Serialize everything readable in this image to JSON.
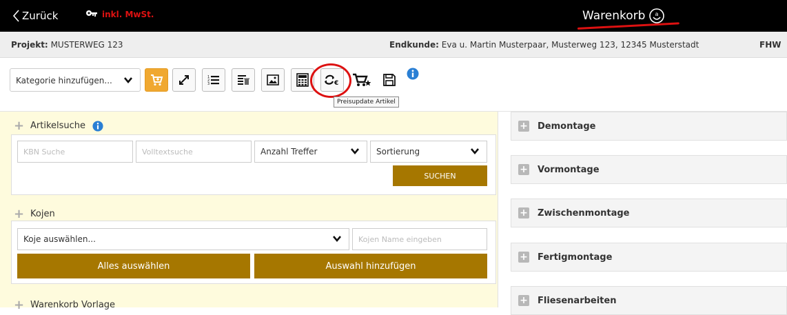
{
  "header": {
    "back_label": "Zurück",
    "mwst_label": "inkl. MwSt.",
    "title": "Warenkorb"
  },
  "project_bar": {
    "project_label": "Projekt:",
    "project_value": "MUSTERWEG 123",
    "customer_label": "Endkunde:",
    "customer_value": "Eva u. Martin Musterpaar, Musterweg 123, 12345 Musterstadt",
    "fhw": "FHW"
  },
  "toolbar": {
    "category_select": "Kategorie hinzufügen...",
    "tooltip": "Preisupdate Artikel"
  },
  "artikelsuche": {
    "title": "Artikelsuche",
    "kbn_placeholder": "KBN Suche",
    "volltext_placeholder": "Volltextsuche",
    "anzahl_select": "Anzahl Treffer",
    "sortierung_select": "Sortierung",
    "search_button": "SUCHEN"
  },
  "kojen": {
    "title": "Kojen",
    "koje_select": "Koje auswählen...",
    "name_placeholder": "Kojen Name eingeben",
    "select_all_button": "Alles auswählen",
    "add_selection_button": "Auswahl hinzufügen"
  },
  "warenkorb_vorlage": {
    "title": "Warenkorb Vorlage"
  },
  "right_sections": [
    {
      "label": "Demontage"
    },
    {
      "label": "Vormontage"
    },
    {
      "label": "Zwischenmontage"
    },
    {
      "label": "Fertigmontage"
    },
    {
      "label": "Fliesenarbeiten"
    }
  ],
  "colors": {
    "accent": "#f0a830",
    "button_brown": "#a67700",
    "annotation_red": "#d11111",
    "left_bg": "#fefbdd"
  }
}
